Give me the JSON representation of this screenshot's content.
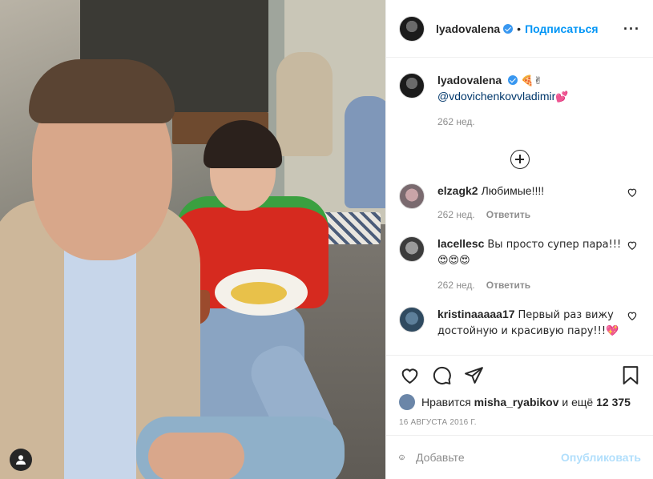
{
  "post": {
    "author": "lyadovalena",
    "follow_label": "Подписаться",
    "caption_mention": "@vdovichenkovvladimir",
    "caption_emoji_pre": "🍕✌",
    "caption_emoji_post": "💕",
    "caption_time": "262 нед.",
    "likes_prefix": "Нравится",
    "liked_by": "misha_ryabikov",
    "likes_suffix": "и ещё",
    "likes_count": "12 375",
    "date": "16 августа 2016 г."
  },
  "comments": [
    {
      "user": "elzagk2",
      "text": "Любимые!!!!",
      "time": "262 нед.",
      "reply": "Ответить"
    },
    {
      "user": "lacellesc",
      "text": "Вы просто супер пара!!!😍😍😍",
      "time": "262 нед.",
      "reply": "Ответить"
    },
    {
      "user": "kristinaaaaa17",
      "text": "Первый раз вижу достойную и красивую пару!!!💖",
      "time": "",
      "reply": ""
    }
  ],
  "composer": {
    "placeholder": "Добавьте",
    "publish_label": "Опубликовать"
  }
}
